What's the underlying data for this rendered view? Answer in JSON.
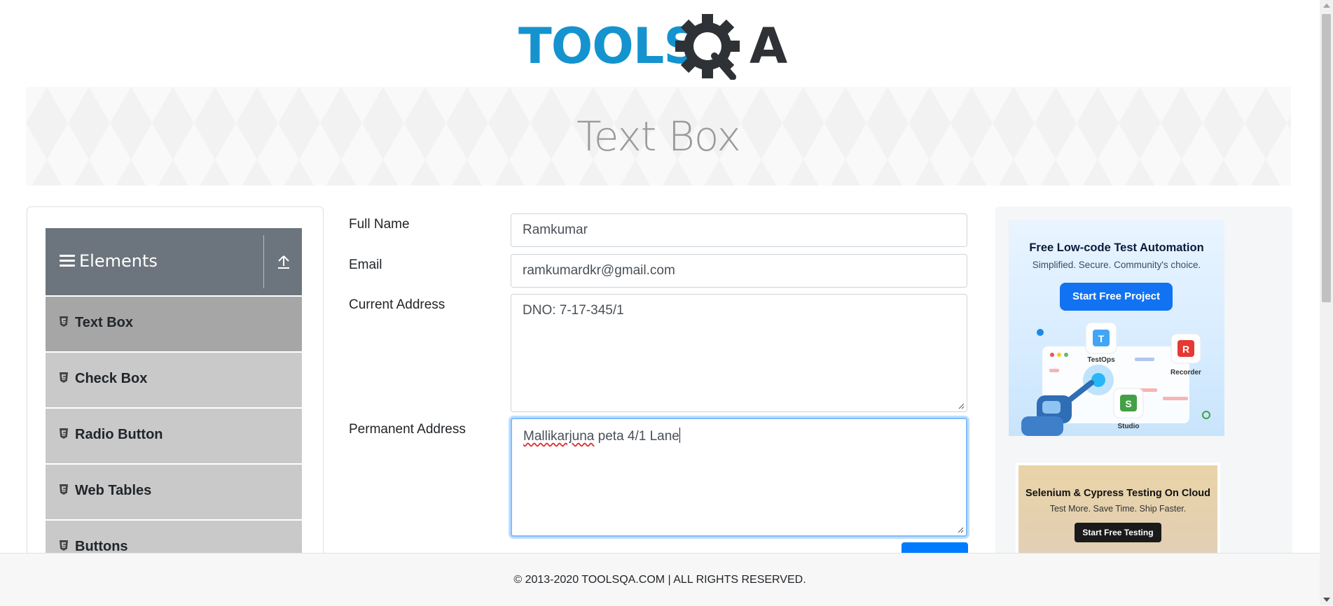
{
  "logo": {
    "part1": "TOOLS",
    "part2": "A"
  },
  "banner": {
    "title": "Text Box"
  },
  "sidebar": {
    "group_title": "Elements",
    "items": [
      {
        "label": "Text Box",
        "active": true
      },
      {
        "label": "Check Box"
      },
      {
        "label": "Radio Button"
      },
      {
        "label": "Web Tables"
      },
      {
        "label": "Buttons"
      }
    ]
  },
  "form": {
    "full_name": {
      "label": "Full Name",
      "value": "Ramkumar"
    },
    "email": {
      "label": "Email",
      "value": "ramkumardkr@gmail.com"
    },
    "current_address": {
      "label": "Current Address",
      "value": "DNO: 7-17-345/1"
    },
    "permanent_address": {
      "label": "Permanent Address",
      "value_misspelled": "Mallikarjuna",
      "value_rest": " peta 4/1 Lane"
    }
  },
  "ads": {
    "ad1": {
      "title": "Free Low-code Test Automation",
      "subtitle": "Simplified. Secure. Community's choice.",
      "button": "Start Free Project",
      "labels": {
        "testops": "TestOps",
        "recorder": "Recorder",
        "studio": "Studio"
      },
      "icon_letters": {
        "testops": "T",
        "recorder": "R",
        "studio": "S"
      }
    },
    "ad2": {
      "title": "Selenium & Cypress Testing On Cloud",
      "subtitle": "Test More. Save Time. Ship Faster.",
      "button": "Start Free Testing"
    }
  },
  "footer": {
    "text": "© 2013-2020 TOOLSQA.COM | ALL RIGHTS RESERVED."
  },
  "colors": {
    "brand_blue": "#1593cf",
    "brand_dark": "#2e3135",
    "accent": "#007bff",
    "sidebar_header": "#6c757d"
  }
}
